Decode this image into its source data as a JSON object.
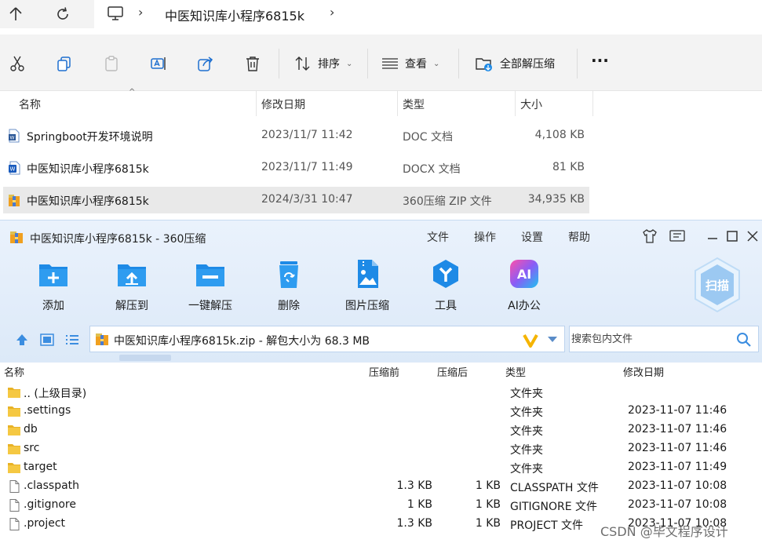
{
  "explorer": {
    "breadcrumb": {
      "folder": "中医知识库小程序6815k"
    },
    "toolbar": {
      "sort_label": "排序",
      "view_label": "查看",
      "extract_all_label": "全部解压缩",
      "more_label": "···"
    },
    "columns": {
      "name": "名称",
      "modified": "修改日期",
      "type": "类型",
      "size": "大小"
    },
    "files": [
      {
        "name": "Springboot开发环境说明",
        "modified": "2023/11/7 11:42",
        "type": "DOC 文档",
        "size": "4,108 KB",
        "icon": "word-doc-icon"
      },
      {
        "name": "中医知识库小程序6815k",
        "modified": "2023/11/7 11:49",
        "type": "DOCX 文档",
        "size": "81 KB",
        "icon": "word-docx-icon"
      },
      {
        "name": "中医知识库小程序6815k",
        "modified": "2024/3/31 10:47",
        "type": "360压缩 ZIP 文件",
        "size": "34,935 KB",
        "icon": "zip-archive-icon"
      }
    ]
  },
  "zip": {
    "title": "中医知识库小程序6815k - 360压缩",
    "menu": {
      "file": "文件",
      "operate": "操作",
      "settings": "设置",
      "help": "帮助"
    },
    "tools": {
      "add": "添加",
      "extract_to": "解压到",
      "one_click_extract": "一键解压",
      "delete": "删除",
      "image_compress": "图片压缩",
      "tools": "工具",
      "ai_office": "AI办公",
      "scan": "扫描",
      "ai_badge": "AI"
    },
    "path": "中医知识库小程序6815k.zip - 解包大小为 68.3 MB",
    "search_placeholder": "搜索包内文件",
    "columns": {
      "name": "名称",
      "before": "压缩前",
      "after": "压缩后",
      "type": "类型",
      "modified": "修改日期"
    },
    "rows": [
      {
        "name": ".. (上级目录)",
        "before": "",
        "after": "",
        "type": "文件夹",
        "modified": "",
        "kind": "folder"
      },
      {
        "name": ".settings",
        "before": "",
        "after": "",
        "type": "文件夹",
        "modified": "2023-11-07 11:46",
        "kind": "folder"
      },
      {
        "name": "db",
        "before": "",
        "after": "",
        "type": "文件夹",
        "modified": "2023-11-07 11:46",
        "kind": "folder"
      },
      {
        "name": "src",
        "before": "",
        "after": "",
        "type": "文件夹",
        "modified": "2023-11-07 11:46",
        "kind": "folder"
      },
      {
        "name": "target",
        "before": "",
        "after": "",
        "type": "文件夹",
        "modified": "2023-11-07 11:49",
        "kind": "folder"
      },
      {
        "name": ".classpath",
        "before": "1.3 KB",
        "after": "1 KB",
        "type": "CLASSPATH 文件",
        "modified": "2023-11-07 10:08",
        "kind": "file"
      },
      {
        "name": ".gitignore",
        "before": "1 KB",
        "after": "1 KB",
        "type": "GITIGNORE 文件",
        "modified": "2023-11-07 10:08",
        "kind": "file"
      },
      {
        "name": ".project",
        "before": "1.3 KB",
        "after": "1 KB",
        "type": "PROJECT 文件",
        "modified": "2023-11-07 10:08",
        "kind": "file"
      }
    ]
  },
  "watermark": "CSDN @毕文程序设计",
  "colors": {
    "accent": "#1e8ae6",
    "folder": "#f5c842",
    "selection": "#e9e9e9"
  }
}
